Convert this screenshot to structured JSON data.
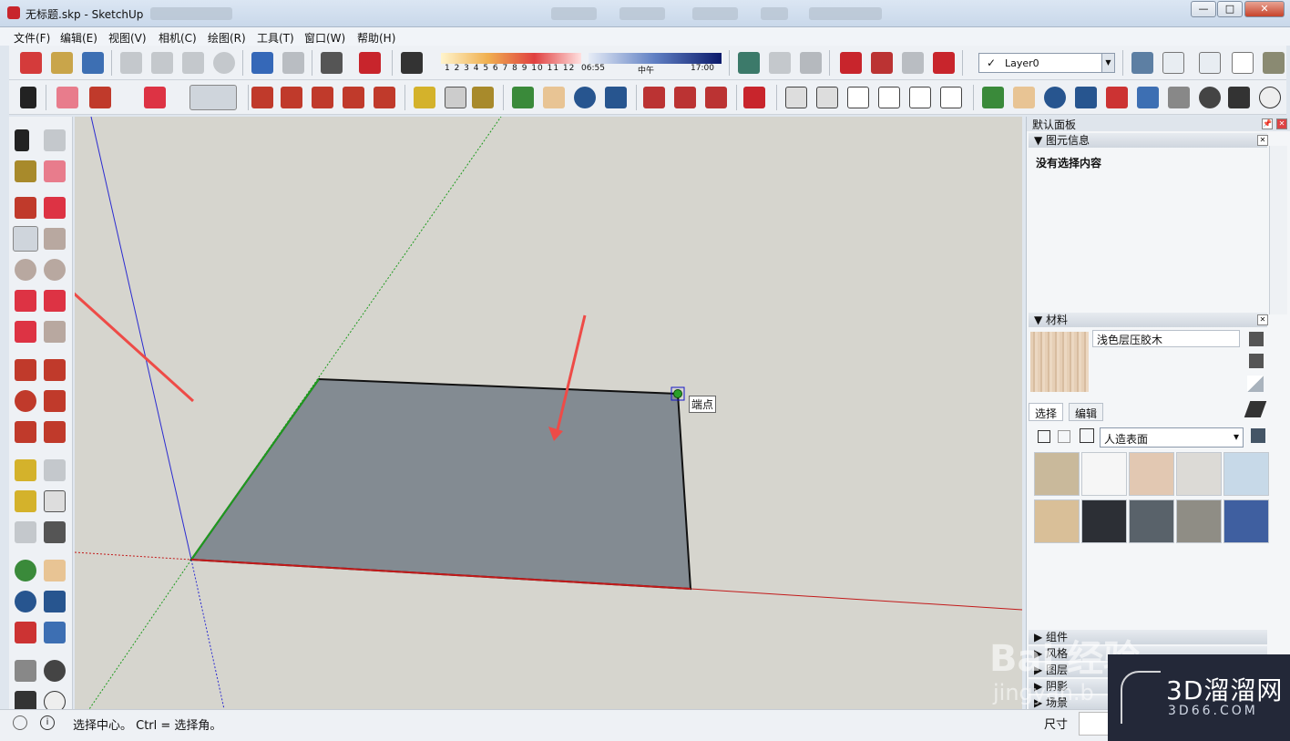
{
  "window": {
    "title": "无标题.skp - SketchUp",
    "min": "—",
    "max": "□",
    "close": "✕"
  },
  "menu": [
    "文件(F)",
    "编辑(E)",
    "视图(V)",
    "相机(C)",
    "绘图(R)",
    "工具(T)",
    "窗口(W)",
    "帮助(H)"
  ],
  "shadow": {
    "months": "1 2 3 4 5 6 7 8 9 10 11 12",
    "time_start": "06:55",
    "time_mid": "中午",
    "time_end": "17:00"
  },
  "layer": {
    "check": "✓",
    "name": "Layer0",
    "dropdown": "▼"
  },
  "viewport": {
    "inference_tooltip": "端点"
  },
  "tray": {
    "title": "默认面板",
    "pin": "📌",
    "close": "✕",
    "entity_info": {
      "header": "▼ 图元信息",
      "message": "没有选择内容"
    },
    "materials": {
      "header": "▼ 材料",
      "current_name": "浅色层压胶木",
      "tab_select": "选择",
      "tab_edit": "编辑",
      "collection": "人造表面",
      "collection_dd": "▾",
      "swatch_colors": [
        "#c9b99b",
        "#f6f6f6",
        "#e2c8b2",
        "#dcdad6",
        "#c7d9e8",
        "#d9bf98",
        "#2c2f35",
        "#59626a",
        "#8f8d85",
        "#3f5fa0"
      ]
    },
    "collapsed_sections": [
      "▶ 组件",
      "▶ 风格",
      "▶ 图层",
      "▶ 阴影",
      "▶ 场景"
    ]
  },
  "status": {
    "text": "选择中心。  Ctrl = 选择角。",
    "dim_label": "尺寸"
  },
  "watermark": {
    "brand": "3D溜溜网",
    "url": "3D66.COM",
    "baidu": "Bai  经验",
    "jingyan": "jingyan.b"
  },
  "colors": {
    "axis_red": "#c21a1a",
    "axis_green": "#1e9b1e",
    "axis_blue": "#2a2ad0",
    "face": "#838b92",
    "arrow": "#ee4b47"
  }
}
